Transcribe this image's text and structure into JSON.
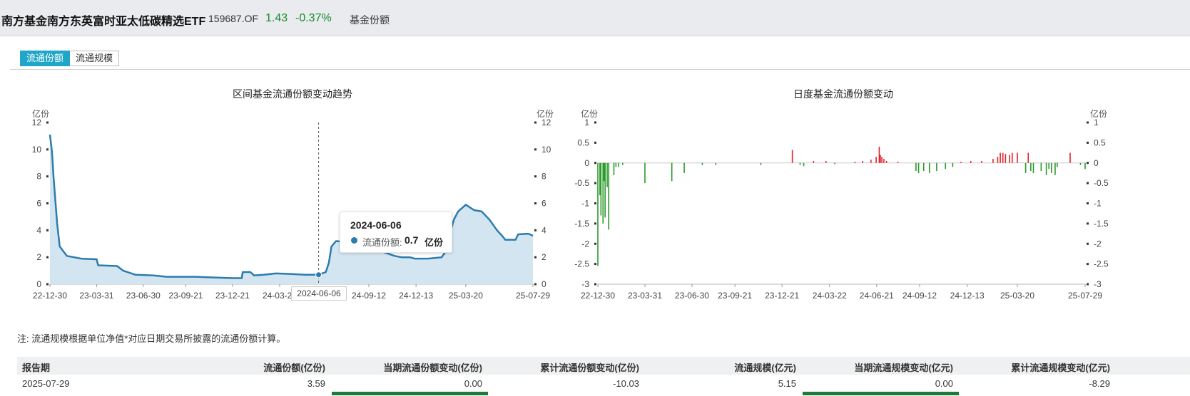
{
  "header": {
    "fund_name": "南方基金南方东英富时亚太低碳精选ETF",
    "code": "159687.OF",
    "price": "1.43",
    "change_pct": "-0.37%",
    "section_label": "基金份额"
  },
  "tabs": [
    {
      "label": "流通份额",
      "active": true
    },
    {
      "label": "流通规模",
      "active": false
    }
  ],
  "left_chart": {
    "title": "区间基金流通份额变动趋势",
    "unit_left": "亿份",
    "unit_right": "亿份",
    "tooltip": {
      "date": "2024-06-06",
      "series": "流通份额:",
      "value": "0.7",
      "unit": "亿份"
    },
    "crosshair_label": "2024-06-06"
  },
  "right_chart": {
    "title": "日度基金流通份额变动",
    "unit_left": "亿份",
    "unit_right": "亿份"
  },
  "chart_data": [
    {
      "type": "area",
      "title": "区间基金流通份额变动趋势",
      "ylabel": "亿份",
      "ylim": [
        0,
        12
      ],
      "yticks": [
        0,
        2,
        4,
        6,
        8,
        10,
        12
      ],
      "xticks": [
        "22-12-30",
        "23-03-31",
        "23-06-30",
        "23-09-21",
        "23-12-21",
        "24-03-22",
        "24-09-12",
        "24-12-13",
        "25-03-20",
        "25-07-29"
      ],
      "color": "#2b7cad",
      "fill": "#d3e5f0",
      "series": [
        {
          "points": [
            [
              "2022-12-30",
              11.1
            ],
            [
              "2023-01-03",
              9.8
            ],
            [
              "2023-01-06",
              8.0
            ],
            [
              "2023-01-10",
              6.0
            ],
            [
              "2023-01-13",
              4.5
            ],
            [
              "2023-01-18",
              2.8
            ],
            [
              "2023-01-24",
              2.5
            ],
            [
              "2023-02-01",
              2.1
            ],
            [
              "2023-02-15",
              2.0
            ],
            [
              "2023-03-01",
              1.9
            ],
            [
              "2023-03-31",
              1.85
            ],
            [
              "2023-04-03",
              1.4
            ],
            [
              "2023-05-10",
              1.35
            ],
            [
              "2023-05-22",
              1.0
            ],
            [
              "2023-06-15",
              0.7
            ],
            [
              "2023-07-20",
              0.65
            ],
            [
              "2023-08-15",
              0.55
            ],
            [
              "2023-10-10",
              0.55
            ],
            [
              "2023-11-10",
              0.5
            ],
            [
              "2023-12-21",
              0.45
            ],
            [
              "2024-01-08",
              0.45
            ],
            [
              "2024-01-10",
              0.9
            ],
            [
              "2024-01-25",
              0.9
            ],
            [
              "2024-02-01",
              0.65
            ],
            [
              "2024-02-20",
              0.7
            ],
            [
              "2024-03-15",
              0.8
            ],
            [
              "2024-04-15",
              0.75
            ],
            [
              "2024-05-10",
              0.7
            ],
            [
              "2024-06-06",
              0.7
            ],
            [
              "2024-06-20",
              0.9
            ],
            [
              "2024-06-26",
              1.6
            ],
            [
              "2024-07-01",
              2.8
            ],
            [
              "2024-07-10",
              3.2
            ],
            [
              "2024-08-10",
              3.1
            ],
            [
              "2024-09-05",
              2.8
            ],
            [
              "2024-09-20",
              2.6
            ],
            [
              "2024-10-10",
              2.4
            ],
            [
              "2024-11-01",
              2.1
            ],
            [
              "2024-11-15",
              2.0
            ],
            [
              "2024-12-01",
              2.0
            ],
            [
              "2024-12-10",
              1.9
            ],
            [
              "2025-01-05",
              1.9
            ],
            [
              "2025-02-01",
              2.0
            ],
            [
              "2025-02-10",
              2.5
            ],
            [
              "2025-02-15",
              3.5
            ],
            [
              "2025-02-25",
              4.8
            ],
            [
              "2025-03-05",
              5.4
            ],
            [
              "2025-03-20",
              5.9
            ],
            [
              "2025-04-05",
              5.5
            ],
            [
              "2025-04-20",
              5.4
            ],
            [
              "2025-05-05",
              4.8
            ],
            [
              "2025-05-20",
              4.0
            ],
            [
              "2025-06-01",
              3.5
            ],
            [
              "2025-06-05",
              3.3
            ],
            [
              "2025-06-25",
              3.3
            ],
            [
              "2025-06-30",
              3.7
            ],
            [
              "2025-07-20",
              3.75
            ],
            [
              "2025-07-29",
              3.6
            ]
          ]
        }
      ]
    },
    {
      "type": "bar",
      "title": "日度基金流通份额变动",
      "ylabel": "亿份",
      "ylim": [
        -3,
        1
      ],
      "yticks": [
        -3,
        -2.5,
        -2,
        -1.5,
        -1,
        -0.5,
        0,
        0.5,
        1
      ],
      "xticks": [
        "22-12-30",
        "23-03-31",
        "23-06-30",
        "23-09-21",
        "23-12-21",
        "24-03-22",
        "24-06-21",
        "24-09-12",
        "24-12-13",
        "25-03-20",
        "25-07-29"
      ],
      "positive_color": "#e0232b",
      "negative_color": "#2a9a2a",
      "series": [
        {
          "points": [
            [
              "2022-12-30",
              -2.55
            ],
            [
              "2023-01-03",
              -0.8
            ],
            [
              "2023-01-05",
              -1.3
            ],
            [
              "2023-01-09",
              -1.5
            ],
            [
              "2023-01-11",
              -0.45
            ],
            [
              "2023-01-13",
              -1.35
            ],
            [
              "2023-01-17",
              -0.6
            ],
            [
              "2023-01-20",
              -1.65
            ],
            [
              "2023-01-30",
              -0.3
            ],
            [
              "2023-02-03",
              -0.1
            ],
            [
              "2023-02-08",
              -0.1
            ],
            [
              "2023-02-16",
              -0.05
            ],
            [
              "2023-03-31",
              -0.5
            ],
            [
              "2023-05-22",
              -0.45
            ],
            [
              "2023-06-15",
              -0.25
            ],
            [
              "2023-07-20",
              -0.05
            ],
            [
              "2023-08-15",
              -0.05
            ],
            [
              "2023-11-10",
              -0.05
            ],
            [
              "2024-01-10",
              0.32
            ],
            [
              "2024-01-25",
              -0.05
            ],
            [
              "2024-02-01",
              -0.08
            ],
            [
              "2024-02-20",
              0.05
            ],
            [
              "2024-03-15",
              0.05
            ],
            [
              "2024-04-01",
              -0.03
            ],
            [
              "2024-05-10",
              0.03
            ],
            [
              "2024-05-25",
              0.05
            ],
            [
              "2024-06-10",
              0.08
            ],
            [
              "2024-06-20",
              0.15
            ],
            [
              "2024-06-26",
              0.4
            ],
            [
              "2024-06-28",
              0.2
            ],
            [
              "2024-07-01",
              0.15
            ],
            [
              "2024-07-05",
              0.1
            ],
            [
              "2024-07-10",
              0.05
            ],
            [
              "2024-08-01",
              0.03
            ],
            [
              "2024-09-05",
              -0.2
            ],
            [
              "2024-09-10",
              -0.25
            ],
            [
              "2024-09-20",
              -0.2
            ],
            [
              "2024-10-01",
              -0.25
            ],
            [
              "2024-10-15",
              -0.2
            ],
            [
              "2024-11-01",
              -0.15
            ],
            [
              "2024-11-15",
              -0.1
            ],
            [
              "2024-12-01",
              0.03
            ],
            [
              "2024-12-20",
              0.05
            ],
            [
              "2025-01-10",
              0.05
            ],
            [
              "2025-02-01",
              0.1
            ],
            [
              "2025-02-10",
              0.15
            ],
            [
              "2025-02-15",
              0.25
            ],
            [
              "2025-02-20",
              0.25
            ],
            [
              "2025-02-25",
              0.22
            ],
            [
              "2025-03-05",
              0.2
            ],
            [
              "2025-03-10",
              0.25
            ],
            [
              "2025-03-20",
              0.25
            ],
            [
              "2025-04-05",
              -0.25
            ],
            [
              "2025-04-10",
              0.25
            ],
            [
              "2025-04-15",
              -0.2
            ],
            [
              "2025-04-20",
              -0.25
            ],
            [
              "2025-05-05",
              -0.2
            ],
            [
              "2025-05-15",
              -0.3
            ],
            [
              "2025-05-20",
              -0.15
            ],
            [
              "2025-05-25",
              -0.25
            ],
            [
              "2025-06-01",
              -0.3
            ],
            [
              "2025-06-05",
              -0.1
            ],
            [
              "2025-06-30",
              0.25
            ],
            [
              "2025-07-20",
              -0.05
            ],
            [
              "2025-07-29",
              -0.15
            ]
          ]
        }
      ]
    }
  ],
  "note": "注:   流通规模根据单位净值*对应日期交易所披露的流通份额计算。",
  "table": {
    "columns": [
      "报告期",
      "流通份额(亿份)",
      "当期流通份额变动(亿份)",
      "累计流通份额变动(亿份)",
      "流通规模(亿元)",
      "当期流通规模变动(亿元)",
      "累计流通规模变动(亿元)"
    ],
    "rows": [
      [
        "2025-07-29",
        "3.59",
        "0.00",
        "-10.03",
        "5.15",
        "0.00",
        "-8.29"
      ]
    ]
  }
}
